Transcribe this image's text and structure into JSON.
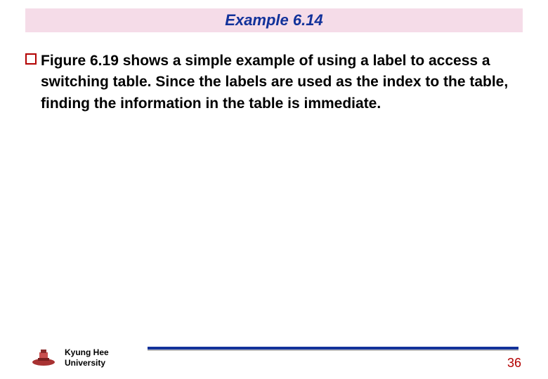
{
  "title": "Example 6.14",
  "body": {
    "paragraph": "Figure 6.19 shows a simple example of using a label to access a switching table. Since the labels are used as the index to the table, finding the information in the table is immediate."
  },
  "footer": {
    "university_line1": "Kyung Hee",
    "university_line2": "University",
    "page_number": "36"
  },
  "colors": {
    "title_bg": "#f5dce8",
    "title_fg": "#12329a",
    "bullet_border": "#b30000",
    "rule": "#12329a",
    "page_number": "#b30000"
  }
}
